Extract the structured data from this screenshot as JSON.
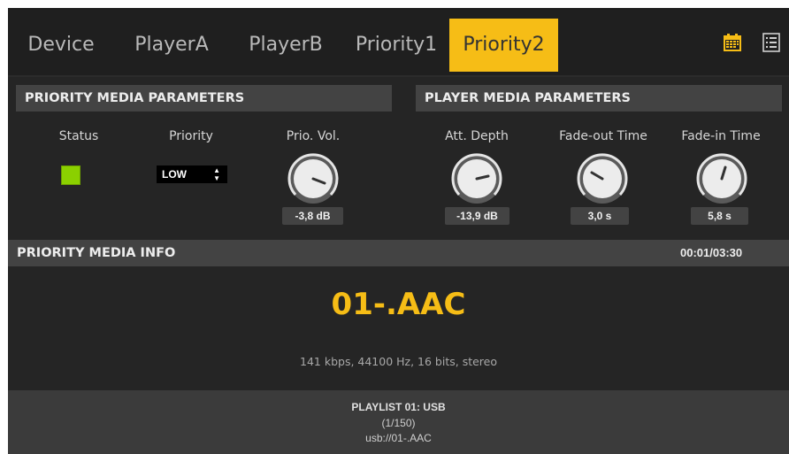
{
  "tabs": [
    {
      "label": "Device"
    },
    {
      "label": "PlayerA"
    },
    {
      "label": "PlayerB"
    },
    {
      "label": "Priority1"
    },
    {
      "label": "Priority2",
      "active": true
    }
  ],
  "toolbar": {
    "calendar_icon": "calendar-icon",
    "list_icon": "list-icon"
  },
  "priority_media_parameters": {
    "title": "PRIORITY MEDIA PARAMETERS",
    "status_label": "Status",
    "priority_label": "Priority",
    "priority_value": "LOW",
    "prio_vol_label": "Prio. Vol.",
    "prio_vol_value": "-3,8 dB"
  },
  "player_media_parameters": {
    "title": "PLAYER MEDIA PARAMETERS",
    "att_depth_label": "Att. Depth",
    "att_depth_value": "-13,9 dB",
    "fade_out_label": "Fade-out Time",
    "fade_out_value": "3,0 s",
    "fade_in_label": "Fade-in Time",
    "fade_in_value": "5,8 s"
  },
  "priority_media_info": {
    "title": "PRIORITY MEDIA INFO",
    "time": "00:01/03:30",
    "track": "01-.AAC",
    "details": "141 kbps, 44100 Hz, 16 bits, stereo"
  },
  "playlist": {
    "title": "PLAYLIST 01: USB",
    "position": "(1/150)",
    "path": "usb://01-.AAC"
  },
  "colors": {
    "accent": "#f6bd16",
    "status_on": "#8bd000",
    "bar": "#434343"
  }
}
